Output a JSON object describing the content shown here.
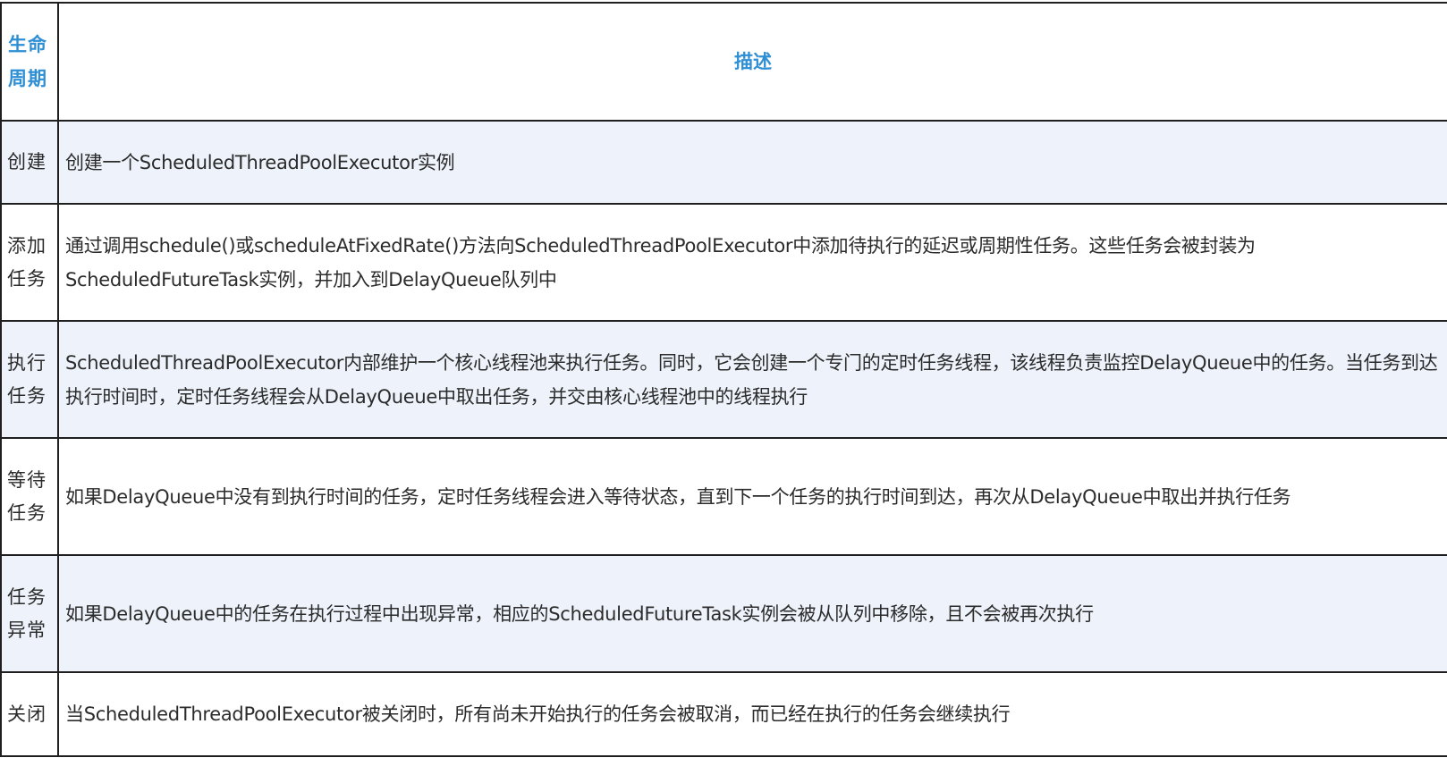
{
  "table": {
    "header": {
      "phase": "生命周期",
      "desc": "描述"
    },
    "rows": [
      {
        "phase": "创建",
        "desc": "创建一个ScheduledThreadPoolExecutor实例"
      },
      {
        "phase": "添加任务",
        "desc": "通过调用schedule()或scheduleAtFixedRate()方法向ScheduledThreadPoolExecutor中添加待执行的延迟或周期性任务。这些任务会被封装为ScheduledFutureTask实例，并加入到DelayQueue队列中"
      },
      {
        "phase": "执行任务",
        "desc": "ScheduledThreadPoolExecutor内部维护一个核心线程池来执行任务。同时，它会创建一个专门的定时任务线程，该线程负责监控DelayQueue中的任务。当任务到达执行时间时，定时任务线程会从DelayQueue中取出任务，并交由核心线程池中的线程执行"
      },
      {
        "phase": "等待任务",
        "desc": "如果DelayQueue中没有到执行时间的任务，定时任务线程会进入等待状态，直到下一个任务的执行时间到达，再次从DelayQueue中取出并执行任务"
      },
      {
        "phase": "任务异常",
        "desc": "如果DelayQueue中的任务在执行过程中出现异常，相应的ScheduledFutureTask实例会被从队列中移除，且不会被再次执行"
      },
      {
        "phase": "关闭",
        "desc": "当ScheduledThreadPoolExecutor被关闭时，所有尚未开始执行的任务会被取消，而已经在执行的任务会继续执行"
      }
    ]
  }
}
